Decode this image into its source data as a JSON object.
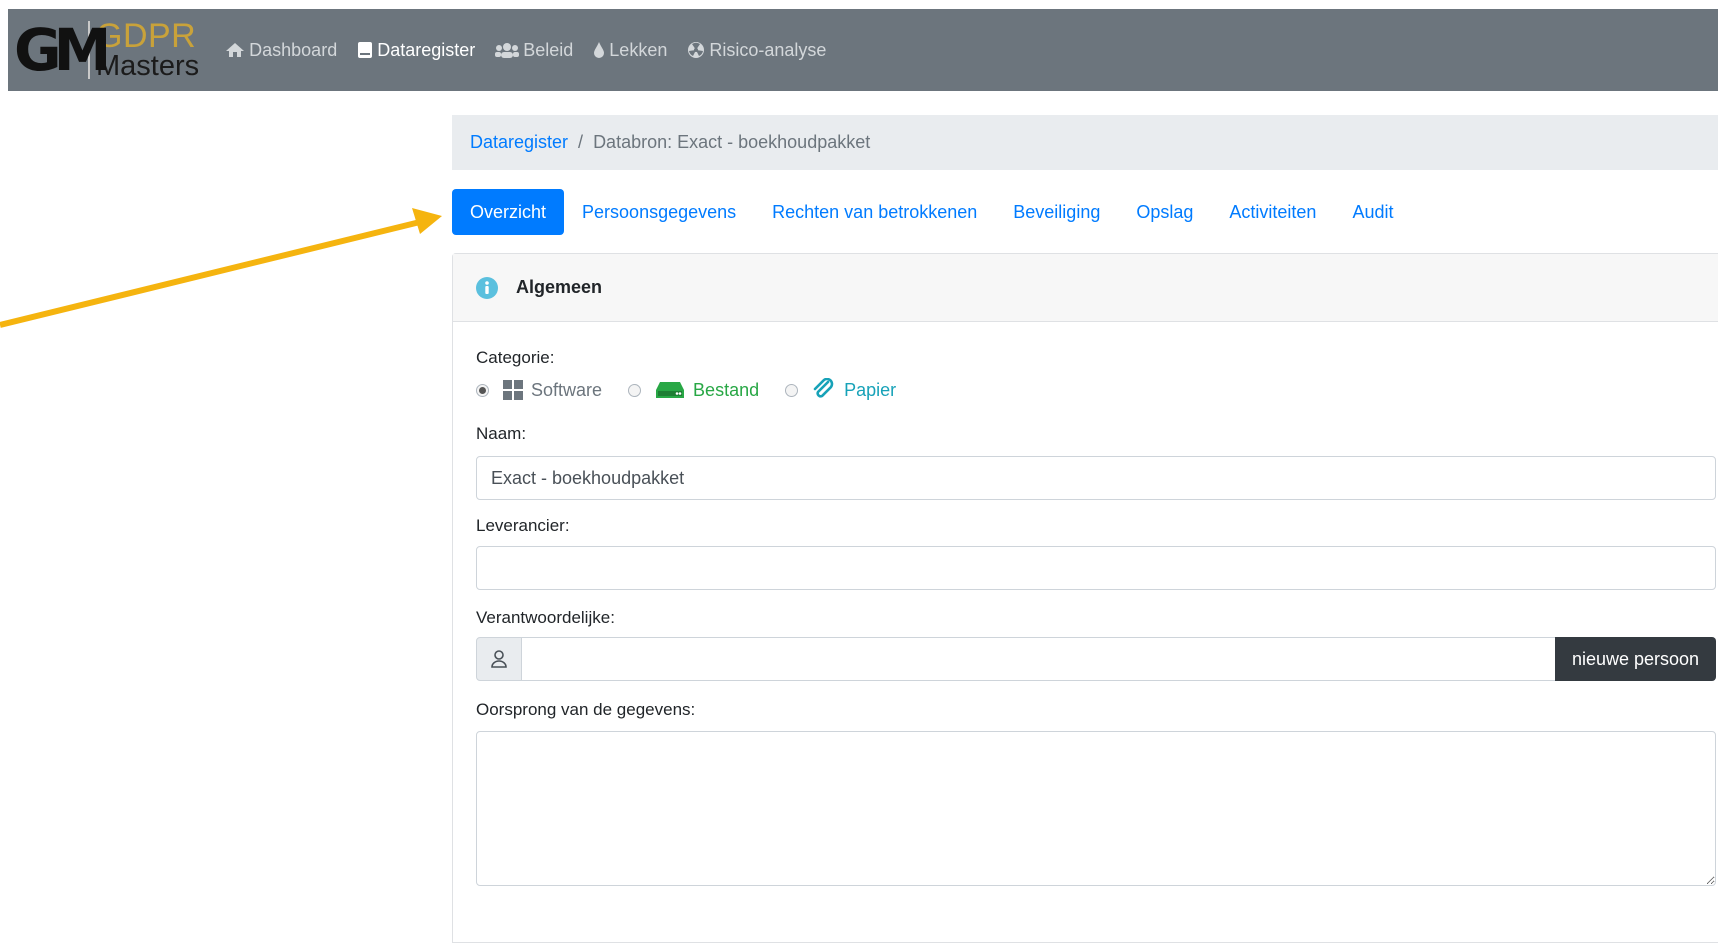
{
  "logo": {
    "mark": "GM",
    "top": "GDPR",
    "bottom": "Masters"
  },
  "nav": [
    {
      "label": "Dashboard",
      "icon": "home-icon"
    },
    {
      "label": "Dataregister",
      "icon": "book-icon",
      "active": true
    },
    {
      "label": "Beleid",
      "icon": "users-icon"
    },
    {
      "label": "Lekken",
      "icon": "drop-icon"
    },
    {
      "label": "Risico-analyse",
      "icon": "radiation-icon"
    }
  ],
  "breadcrumb": {
    "parent": "Dataregister",
    "current": "Databron: Exact - boekhoudpakket"
  },
  "tabs": [
    "Overzicht",
    "Persoonsgegevens",
    "Rechten van betrokkenen",
    "Beveiliging",
    "Opslag",
    "Activiteiten",
    "Audit"
  ],
  "card": {
    "title": "Algemeen",
    "categorie_label": "Categorie:",
    "categories": [
      "Software",
      "Bestand",
      "Papier"
    ],
    "naam_label": "Naam:",
    "naam_value": "Exact - boekhoudpakket",
    "leverancier_label": "Leverancier:",
    "leverancier_value": "",
    "verantwoordelijke_label": "Verantwoordelijke:",
    "verantwoordelijke_value": "",
    "nieuwe_persoon": "nieuwe persoon",
    "oorsprong_label": "Oorsprong van de gegevens:"
  },
  "colors": {
    "primary": "#007bff",
    "navbar": "#6c757d",
    "success": "#28a745",
    "info": "#17a2b8",
    "annotation": "#f5b40f"
  }
}
